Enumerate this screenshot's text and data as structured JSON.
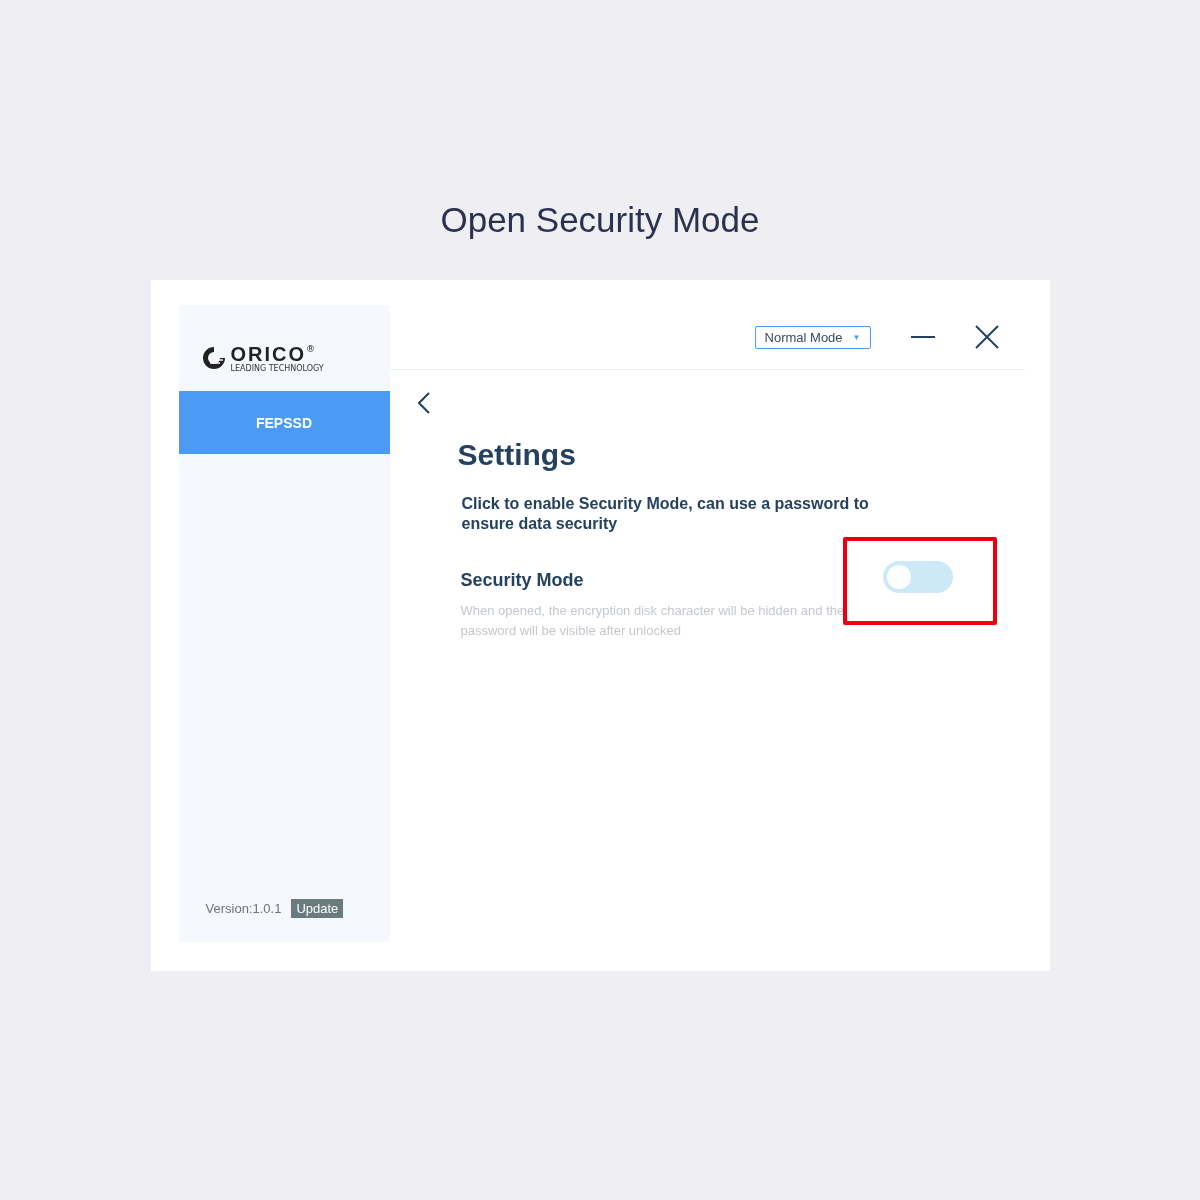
{
  "page_title": "Open Security Mode",
  "sidebar": {
    "logo": {
      "name": "ORICO",
      "mark": "®",
      "tagline": "LEADING TECHNOLOGY"
    },
    "items": [
      {
        "label": "FEPSSD",
        "selected": true
      }
    ],
    "version": "Version:1.0.1",
    "update_button": "Update"
  },
  "top_bar": {
    "mode_dropdown": "Normal Mode",
    "caret": "▼"
  },
  "settings": {
    "title": "Settings",
    "intro": "Click to enable  Security Mode, can use a password to ensure data security",
    "options": [
      {
        "kind": "toggle",
        "label": "Security Mode",
        "description": "When opened, the encryption disk character will be hidden and the password will be visible after unlocked",
        "on": false,
        "highlighted": true
      }
    ]
  }
}
